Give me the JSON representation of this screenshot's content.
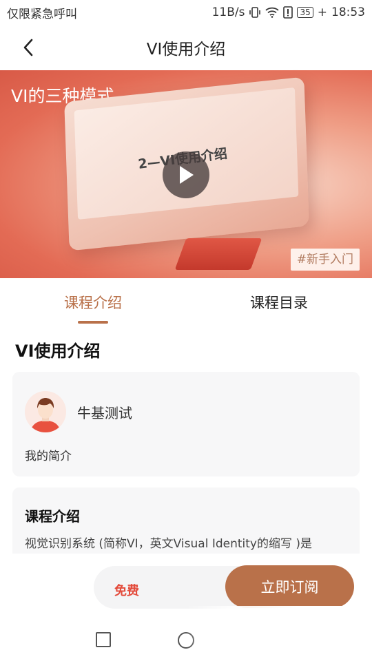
{
  "status_bar": {
    "carrier": "仅限紧急呼叫",
    "net_speed": "11B/s",
    "battery": "35",
    "time": "18:53"
  },
  "nav": {
    "title": "VI使用介绍",
    "back_icon": "chevron-left-icon"
  },
  "banner": {
    "title": "VI的三种模式",
    "screen_text": "2—VI使用介绍",
    "tag": "#新手入门",
    "play_icon": "play-icon"
  },
  "tabs": [
    {
      "label": "课程介绍",
      "active": true
    },
    {
      "label": "课程目录",
      "active": false
    }
  ],
  "course": {
    "title": "VI使用介绍"
  },
  "author": {
    "name": "牛基测试",
    "bio": "我的简介"
  },
  "intro": {
    "heading": "课程介绍",
    "body": "视觉识别系统 (简称VI，英文Visual Identity的缩写 )是"
  },
  "bottom": {
    "price": "免费",
    "subscribe": "立即订阅"
  },
  "colors": {
    "accent": "#b9714a",
    "price_red": "#e34a3a",
    "banner_red": "#e36b55"
  }
}
